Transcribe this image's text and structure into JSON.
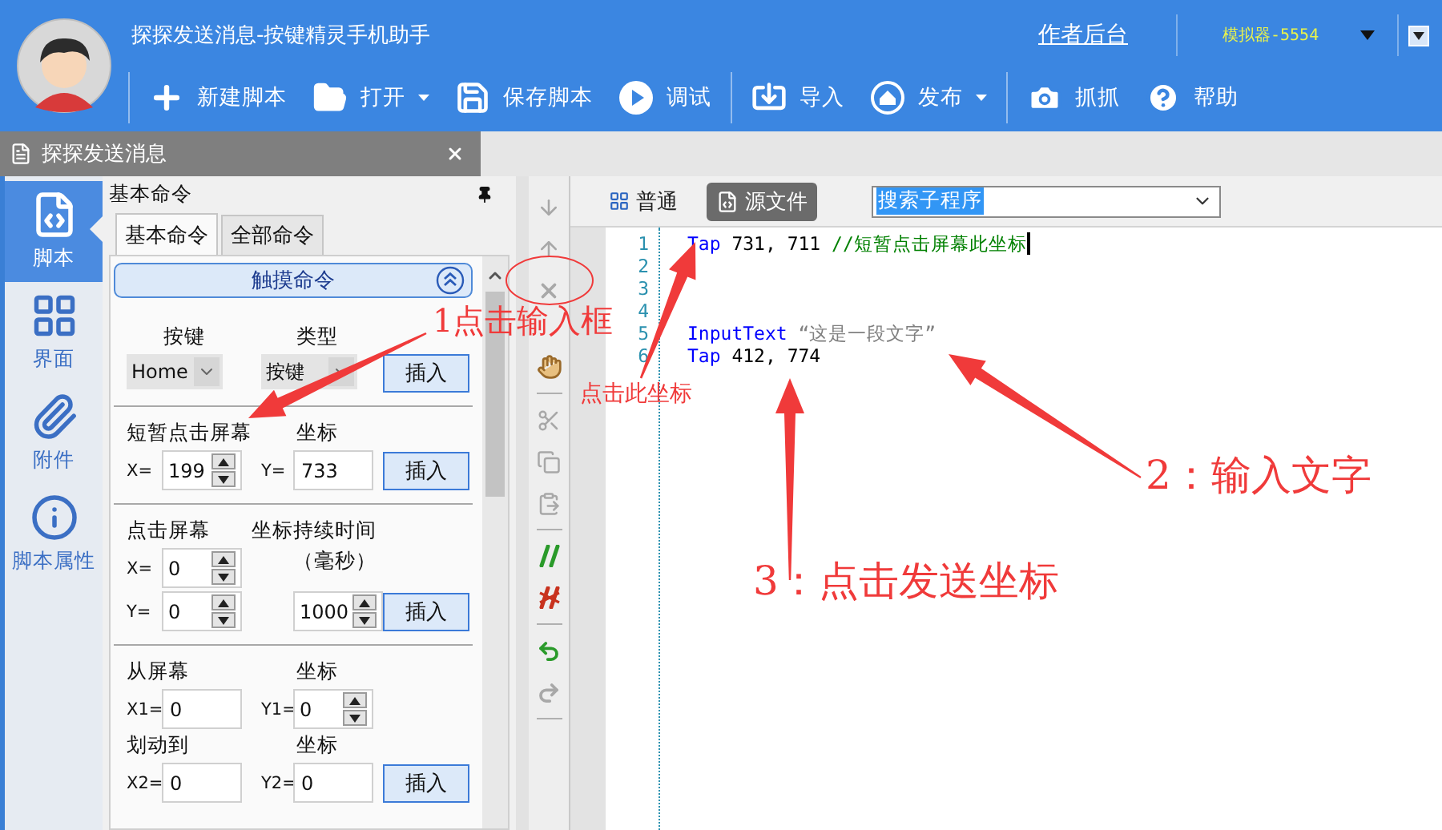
{
  "window": {
    "title": "探探发送消息-按键精灵手机助手"
  },
  "header": {
    "link": "作者后台",
    "device": "模拟器-5554"
  },
  "toolbar": [
    [
      {
        "label": "新建脚本",
        "dropdown": false
      },
      {
        "label": "打开",
        "dropdown": true
      },
      {
        "label": "保存脚本",
        "dropdown": false
      },
      {
        "label": "调试",
        "dropdown": false
      }
    ],
    [
      {
        "label": "导入",
        "dropdown": false
      },
      {
        "label": "发布",
        "dropdown": true
      }
    ],
    [
      {
        "label": "抓抓",
        "dropdown": false
      },
      {
        "label": "帮助",
        "dropdown": false
      }
    ]
  ],
  "document_tab": {
    "label": "探探发送消息"
  },
  "sidebar": {
    "items": [
      {
        "label": "脚本",
        "selected": true
      },
      {
        "label": "界面",
        "selected": false
      },
      {
        "label": "附件",
        "selected": false
      },
      {
        "label": "脚本属性",
        "selected": false
      }
    ]
  },
  "command_panel": {
    "title": "基本命令",
    "tabs": [
      {
        "label": "基本命令",
        "selected": true
      },
      {
        "label": "全部命令",
        "selected": false
      }
    ],
    "group": {
      "title": "触摸命令",
      "expanded": true
    },
    "key_section": {
      "labels": [
        "按键",
        "类型"
      ],
      "selects": [
        "Home",
        "按键"
      ],
      "button": "插入"
    },
    "tap_section": {
      "title": "短暂点击屏幕",
      "coord_label": "坐标",
      "fields": [
        {
          "label": "X=",
          "value": "199",
          "kind": "spin"
        },
        {
          "label": "Y=",
          "value": "733",
          "kind": "field"
        }
      ],
      "button": "插入"
    },
    "press_section": {
      "title": "点击屏幕",
      "coord_label": "坐标",
      "duration_label": [
        "持续时间",
        "（毫秒）"
      ],
      "fields": [
        {
          "label": "X=",
          "value": "0",
          "kind": "spin"
        },
        {
          "label": "Y=",
          "value": "0",
          "kind": "spin"
        }
      ],
      "duration": {
        "value": "1000",
        "kind": "spin"
      },
      "button": "插入"
    },
    "swipe_section": {
      "from_label": "从屏幕",
      "from_coord_label": "坐标",
      "from_fields": [
        {
          "label": "X1=",
          "value": "0",
          "kind": "field"
        },
        {
          "label": "Y1=",
          "value": "0",
          "kind": "spin"
        }
      ],
      "to_label": "划动到",
      "to_coord_label": "坐标",
      "to_fields": [
        {
          "label": "X2=",
          "value": "0",
          "kind": "field"
        },
        {
          "label": "Y2=",
          "value": "0",
          "kind": "field"
        }
      ],
      "button": "插入"
    }
  },
  "editor": {
    "views": [
      {
        "label": "普通",
        "selected": false
      },
      {
        "label": "源文件",
        "selected": true
      }
    ],
    "search": {
      "value": "搜索子程序"
    },
    "lines": [
      {
        "number": "1",
        "cursor": true,
        "tokens": [
          {
            "text": "Tap",
            "kind": "keyword"
          },
          {
            "text": " 731, 711 ",
            "kind": "plain"
          },
          {
            "text": "//短暂点击屏幕此坐标",
            "kind": "comment"
          }
        ]
      },
      {
        "number": "2",
        "cursor": false
      },
      {
        "number": "3",
        "cursor": false
      },
      {
        "number": "4",
        "cursor": false
      },
      {
        "number": "5",
        "cursor": false,
        "tokens": [
          {
            "text": "InputText",
            "kind": "keyword"
          },
          {
            "text": " “这是一段文字”",
            "kind": "string"
          }
        ]
      },
      {
        "number": "6",
        "cursor": false,
        "tokens": [
          {
            "text": "Tap",
            "kind": "keyword"
          },
          {
            "text": " 412, 774",
            "kind": "plain"
          }
        ]
      }
    ]
  },
  "annotations": [
    {
      "text": "1点击输入框",
      "kind": "large"
    },
    {
      "text": "点击此坐标",
      "kind": "small"
    },
    {
      "text": "2：输入文字",
      "kind": "large"
    },
    {
      "text": "3：点击发送坐标",
      "kind": "large"
    }
  ]
}
